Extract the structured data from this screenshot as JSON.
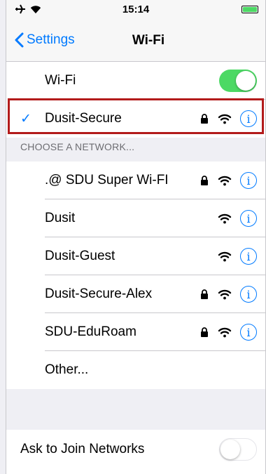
{
  "status_bar": {
    "time": "15:14"
  },
  "nav": {
    "back_label": "Settings",
    "title": "Wi-Fi"
  },
  "wifi_toggle": {
    "label": "Wi-Fi",
    "state": "on"
  },
  "connected": {
    "name": "Dusit-Secure",
    "check": "✓",
    "secured": true
  },
  "section": {
    "header": "CHOOSE A NETWORK..."
  },
  "networks": [
    {
      "name": ".@ SDU Super  Wi-FI",
      "secured": true
    },
    {
      "name": "Dusit",
      "secured": false
    },
    {
      "name": "Dusit-Guest",
      "secured": false
    },
    {
      "name": "Dusit-Secure-Alex",
      "secured": true
    },
    {
      "name": "SDU-EduRoam",
      "secured": true
    }
  ],
  "other": {
    "label": "Other..."
  },
  "ask_join": {
    "label": "Ask to Join Networks",
    "state": "off"
  },
  "info_glyph": "i",
  "colors": {
    "accent": "#007aff",
    "toggle_on": "#4cd964",
    "highlight": "#b31b1b"
  }
}
